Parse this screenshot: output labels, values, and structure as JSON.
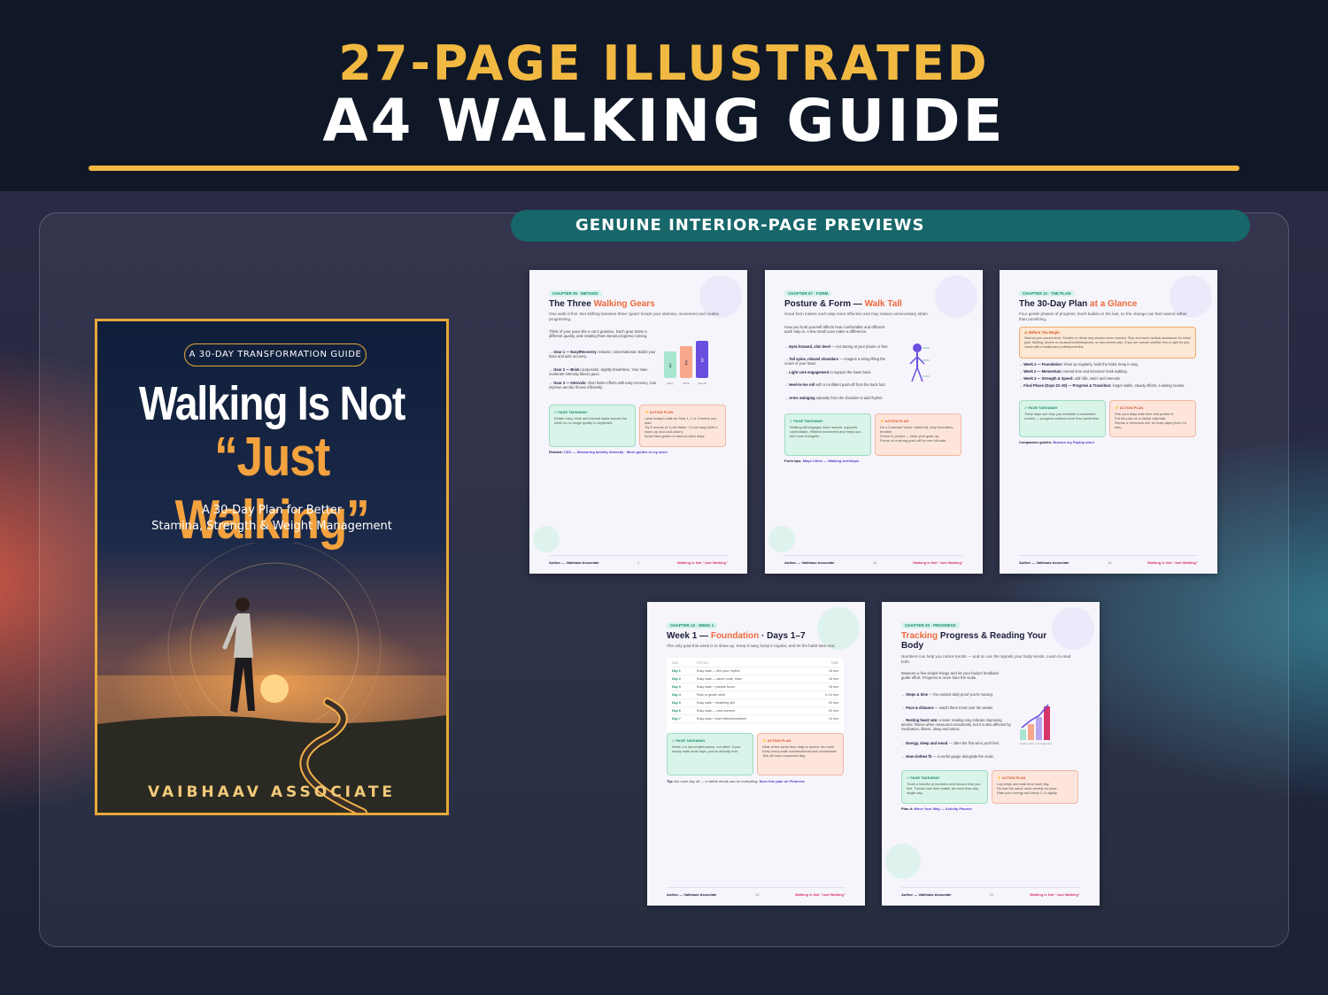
{
  "header": {
    "title_line1": "27-PAGE ILLUSTRATED",
    "title_line2": "A4 WALKING GUIDE"
  },
  "preview_badge": "GENUINE INTERIOR-PAGE PREVIEWS",
  "cover": {
    "tag": "A 30-DAY TRANSFORMATION GUIDE",
    "title_line1": "Walking Is Not",
    "title_line2": "“Just Walking”",
    "subtitle_line1": "A 30-Day Plan for Better",
    "subtitle_line2": "Stamina, Strength & Weight Management",
    "author": "VAIBHAAV ASSOCIATE"
  },
  "footer_common": {
    "author": "Author — Vaibhaav Associate",
    "book": "Walking Is Not “Just Walking”"
  },
  "pages": [
    {
      "chapter": "CHAPTER 06 · METHOD",
      "title_plain": "The Three ",
      "title_highlight": "Walking Gears",
      "subtitle": "One walk is fine. But shifting between three ‘gears’ keeps your stamina, movement and routine progressing.",
      "body": "Think of your pace like a car's gearbox. Each gear trains a different quality, and rotating them keeps progress coming.",
      "bullets": [
        {
          "lead": "Gear 1 — Easy/Recovery:",
          "text": " relaxed, conversational. Builds your base and aids recovery."
        },
        {
          "lead": "Gear 2 — Brisk:",
          "text": " purposeful, slightly breathless. Your main moderate-intensity fitness pace."
        },
        {
          "lead": "Gear 3 — Intervals:",
          "text": " short faster efforts with easy recovery. Can improve aerobic fitness efficiently."
        }
      ],
      "takeaway_head": "✓ PAGE TAKEAWAY",
      "takeaway": "Rotate easy, brisk and interval walks across the week so no single quality is neglected.",
      "action_head": "⚡ ACTION PLAN",
      "actions": [
        "Label today's walk as Gear 1, 2 or 3 before you start.",
        "Try 5 rounds of 1-min faster / 2-min easy (with a warm-up and cool-down).",
        "Avoid hard gears on back-to-back days."
      ],
      "related_label": "Related:",
      "related_links": "CDC — Measuring activity intensity · More guides in my store",
      "gears": [
        {
          "label": "1",
          "name": "Easy",
          "color": "#a8e6cf"
        },
        {
          "label": "2",
          "name": "Brisk",
          "color": "#f7a78a"
        },
        {
          "label": "3",
          "name": "Interval",
          "color": "#6a4ee0"
        }
      ],
      "page_no": "9"
    },
    {
      "chapter": "CHAPTER 07 · FORM",
      "title_plain": "Posture & Form — ",
      "title_highlight": "Walk Tall",
      "subtitle": "Good form makes each step more effective and may reduce unnecessary strain.",
      "body": "How you hold yourself affects how comfortable and efficient each step is. A few small cues make a difference.",
      "bullets": [
        {
          "lead": "Eyes forward, chin level",
          "text": " — not staring at your phone or feet."
        },
        {
          "lead": "Tall spine, relaxed shoulders",
          "text": " — imagine a string lifting the crown of your head."
        },
        {
          "lead": "Light core engagement",
          "text": " to support the lower back."
        },
        {
          "lead": "Heel-to-toe roll",
          "text": " with a confident push-off from the back foot."
        },
        {
          "lead": "Arms swinging",
          "text": " naturally from the shoulder to add rhythm."
        }
      ],
      "takeaway_head": "✓ PAGE TAKEAWAY",
      "takeaway": "Walking tall engages more muscle, supports comfortable, efficient movement and helps you feel more energetic.",
      "action_head": "⚡ ACTION PLAN",
      "actions": [
        "Do a 3-second 'reset': stand tall, drop shoulders, breathe.",
        "Phone in pocket — keep your gaze up.",
        "Focus on a strong push-off for one full walk."
      ],
      "related_label": "Form tips:",
      "related_links": "Mayo Clinic — Walking technique",
      "page_no": "10"
    },
    {
      "chapter": "CHAPTER 12 · THE PLAN",
      "title_plain": "The 30-Day Plan ",
      "title_highlight": "at a Glance",
      "subtitle": "Four gentle phases of progress. Each builds on the last, so the change can feel natural rather than punishing.",
      "warn_head": "⚠ Before You Begin",
      "warn_text": "Start at your current level. Shorten or divide any session when needed. Stop and seek medical assistance for chest pain, fainting, severe or unusual breathlessness, or new severe pain. If you are unsure whether this is right for you, check with a healthcare professional first.",
      "bullets": [
        {
          "lead": "Week 1 — Foundation:",
          "text": " show up regularly, build the habit, keep it easy."
        },
        {
          "lead": "Week 2 — Momentum:",
          "text": " extend time and introduce brisk walking."
        },
        {
          "lead": "Week 3 — Strength & Speed:",
          "text": " add hills, stairs and intervals."
        },
        {
          "lead": "Final Phase (Days 22–30) — Progress & Transition:",
          "text": " longer walks, steady efforts, a lasting routine."
        }
      ],
      "takeaway_head": "✓ PAGE TAKEAWAY",
      "takeaway": "Thirty days can help you establish a consistent routine — progress matters more than perfection.",
      "action_head": "⚡ ACTION PLAN",
      "actions": [
        "Pick your daily walk time and protect it.",
        "Put the plan on a visible calendar.",
        "Decide a 'minimum win' for busy days (even 10 min)."
      ],
      "related_label": "Companion guides:",
      "related_links": "Browse my Payhip store",
      "page_no": "15"
    },
    {
      "chapter": "CHAPTER 13 · WEEK 1",
      "title_plain": "Week 1 — ",
      "title_highlight": "Foundation",
      "title_tail": " · Days 1–7",
      "subtitle": "The only goal this week is to show up. Keep it easy, keep it regular, and let the habit take root.",
      "table_head": [
        "DAY",
        "FOCUS",
        "TIME"
      ],
      "table": [
        [
          "Day 1",
          "Easy walk — find your rhythm",
          "15 min"
        ],
        [
          "Day 2",
          "Easy walk — same route, relax",
          "15 min"
        ],
        [
          "Day 3",
          "Easy walk + posture focus",
          "15 min"
        ],
        [
          "Day 4",
          "Rest or gentle stroll",
          "0–10 min"
        ],
        [
          "Day 5",
          "Easy walk + breathing drill",
          "20 min"
        ],
        [
          "Day 6",
          "Easy walk — new scenery",
          "20 min"
        ],
        [
          "Day 7",
          "Easy walk + brief reflection/stretch",
          "15 min"
        ]
      ],
      "takeaway_head": "✓ PAGE TAKEAWAY",
      "takeaway": "Week 1 is about attendance, not effort. If you simply walk most days, you've already won.",
      "action_head": "⚡ ACTION PLAN",
      "actions": [
        "Walk at the same time daily to anchor the habit.",
        "Keep every walk conversational and comfortable.",
        "Tick off each completed day."
      ],
      "related_label": "Tip:",
      "related_text": " tick each day off — a visible streak can be motivating. ",
      "related_links": "Save this plan on Pinterest",
      "page_no": "16"
    },
    {
      "chapter": "CHAPTER 20 · PROGRESS",
      "title_highlight": "Tracking",
      "title_plain": " Progress & Reading Your Body",
      "subtitle": "Numbers can help you notice trends — and so can the signals your body sends. Learn to read both.",
      "body": "Measure a few simple things and let your body's feedback guide effort. Progress is more than the scale.",
      "bullets": [
        {
          "lead": "Steps & time",
          "text": " — the easiest daily proof you're moving."
        },
        {
          "lead": "Pace & distance",
          "text": " — watch them trend over the weeks."
        },
        {
          "lead": "Resting heart rate:",
          "text": " a lower reading may indicate improving aerobic fitness when measured consistently, but it is also affected by medication, illness, sleep and stress."
        },
        {
          "lead": "Energy, sleep and mood",
          "text": " — often the first wins you'll feel."
        },
        {
          "lead": "How clothes fit",
          "text": " — a useful gauge alongside the scale."
        }
      ],
      "chart_caption": "trends matter, not single days",
      "takeaway_head": "✓ PAGE TAKEAWAY",
      "takeaway": "Track a handful of numbers and honour how you feel. Trends over time matter far more than any single day.",
      "action_head": "⚡ ACTION PLAN",
      "actions": [
        "Log steps and walk time each day.",
        "Re-test the same route weekly for pace.",
        "Rate your energy and sleep 1–5 nightly."
      ],
      "related_label": "Plan it:",
      "related_links": "Move Your Way — Activity Planner",
      "page_no": "22"
    }
  ],
  "colors": {
    "gold": "#f2b942",
    "teal_badge": "#16666a",
    "highlight_orange": "#ef6a3c",
    "footer_pink": "#d8366a"
  }
}
